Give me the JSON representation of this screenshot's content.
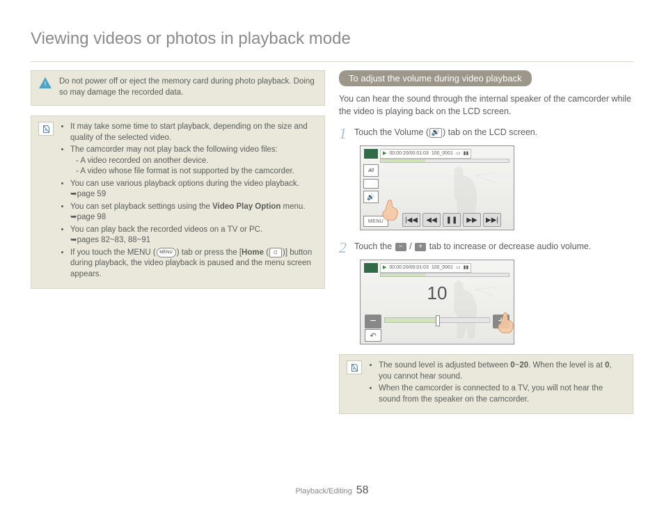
{
  "title": "Viewing videos or photos in playback mode",
  "footer": {
    "section": "Playback/Editing",
    "page": "58"
  },
  "left": {
    "warning": "Do not power off or eject the memory card during photo playback. Doing so may damage the recorded data.",
    "notes": {
      "b1": "It may take some time to start playback, depending on the size and quality of the selected video.",
      "b2": "The camcorder may not play back the following video files:",
      "b2a": "- A video recorded on another device.",
      "b2b": "- A video whose file format is not supported by the camcorder.",
      "b3": "You can use various playback options during the video playback.",
      "b3ref": "page 59",
      "b4a": "You can set playback settings using the ",
      "b4b": "Video Play Option",
      "b4c": " menu.",
      "b4ref": "page 98",
      "b5": "You can play back the recorded videos on a TV or PC.",
      "b5ref": "pages 82~83, 88~91",
      "b6a": "If you touch the MENU (",
      "b6b": ") tab or press the [",
      "b6c": "Home",
      "b6d": " (",
      "b6e": ")] button during playback, the video playback is paused and the menu screen appears.",
      "menuLbl": "MENU"
    }
  },
  "right": {
    "heading": "To adjust the volume during video playback",
    "intro": "You can hear the sound through the internal speaker of the camcorder while the video is playing back on the LCD screen.",
    "step1": {
      "num": "1",
      "a": "Touch the Volume (",
      "b": ") tab on the LCD screen."
    },
    "step2": {
      "num": "2",
      "a": "Touch the ",
      "b": " / ",
      "c": " tab to increase or decrease audio volume."
    },
    "sshot": {
      "time": "00:00:20/00:01:03",
      "file": "100_0001",
      "menu": "MENU",
      "vol": "10"
    },
    "notes": {
      "b1a": "The sound level is adjusted between ",
      "b1b": "0",
      "b1c": "~",
      "b1d": "20",
      "b1e": ". When the level is at ",
      "b1f": "0",
      "b1g": ", you cannot hear sound.",
      "b2": "When the camcorder is connected to a TV, you will not hear the sound from the speaker on the camcorder."
    }
  }
}
